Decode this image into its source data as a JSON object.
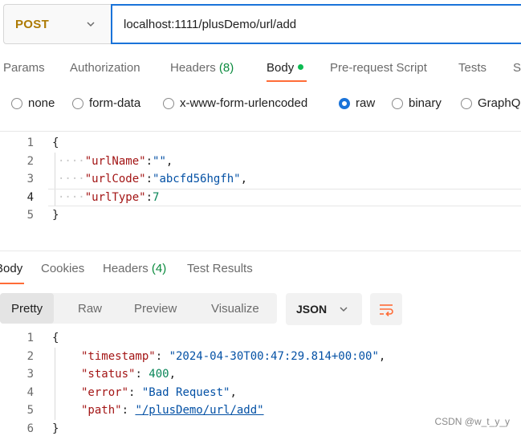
{
  "request": {
    "method": "POST",
    "url": "localhost:1111/plusDemo/url/add"
  },
  "request_tabs": [
    {
      "label": "Params"
    },
    {
      "label": "Authorization"
    },
    {
      "label": "Headers",
      "count": "(8)"
    },
    {
      "label": "Body",
      "active": true
    },
    {
      "label": "Pre-request Script"
    },
    {
      "label": "Tests"
    },
    {
      "label": "S"
    }
  ],
  "body_types": [
    {
      "label": "none"
    },
    {
      "label": "form-data"
    },
    {
      "label": "x-www-form-urlencoded"
    },
    {
      "label": "raw",
      "selected": true
    },
    {
      "label": "binary"
    },
    {
      "label": "GraphQ"
    }
  ],
  "request_body": {
    "line_numbers": [
      "1",
      "2",
      "3",
      "4",
      "5"
    ],
    "lines": [
      "{",
      "\"urlName\":\"\",",
      "\"urlCode\":\"abcfd56hgfh\",",
      "\"urlType\":7",
      "}"
    ],
    "parts": {
      "l2_key": "\"urlName\"",
      "l2_colon": ":",
      "l2_val": "\"\"",
      "l2_comma": ",",
      "l3_key": "\"urlCode\"",
      "l3_colon": ":",
      "l3_val": "\"abcfd56hgfh\"",
      "l3_comma": ",",
      "l4_key": "\"urlType\"",
      "l4_colon": ":",
      "l4_val": "7",
      "indent_dots": "····"
    }
  },
  "response_tabs": [
    {
      "label": "Body",
      "active": true
    },
    {
      "label": "Cookies"
    },
    {
      "label": "Headers",
      "count": "(4)"
    },
    {
      "label": "Test Results"
    }
  ],
  "response_view": {
    "modes": [
      "Pretty",
      "Raw",
      "Preview",
      "Visualize"
    ],
    "active_mode": "Pretty",
    "format": "JSON"
  },
  "response_body": {
    "line_numbers": [
      "1",
      "2",
      "3",
      "4",
      "5",
      "6"
    ],
    "open": "{",
    "close": "}",
    "fields": [
      {
        "key": "\"timestamp\"",
        "value": "\"2024-04-30T00:47:29.814+00:00\"",
        "comma": ","
      },
      {
        "key": "\"status\"",
        "value": "400",
        "comma": ","
      },
      {
        "key": "\"error\"",
        "value": "\"Bad Request\"",
        "comma": ","
      },
      {
        "key": "\"path\"",
        "value": "\"/plusDemo/url/add\"",
        "comma": ""
      }
    ]
  },
  "watermark": "CSDN @w_t_y_y",
  "colors": {
    "accent": "#ff6c37",
    "method": "#ad7a03",
    "selected": "#1a73d9",
    "count": "#0a8a3d"
  }
}
